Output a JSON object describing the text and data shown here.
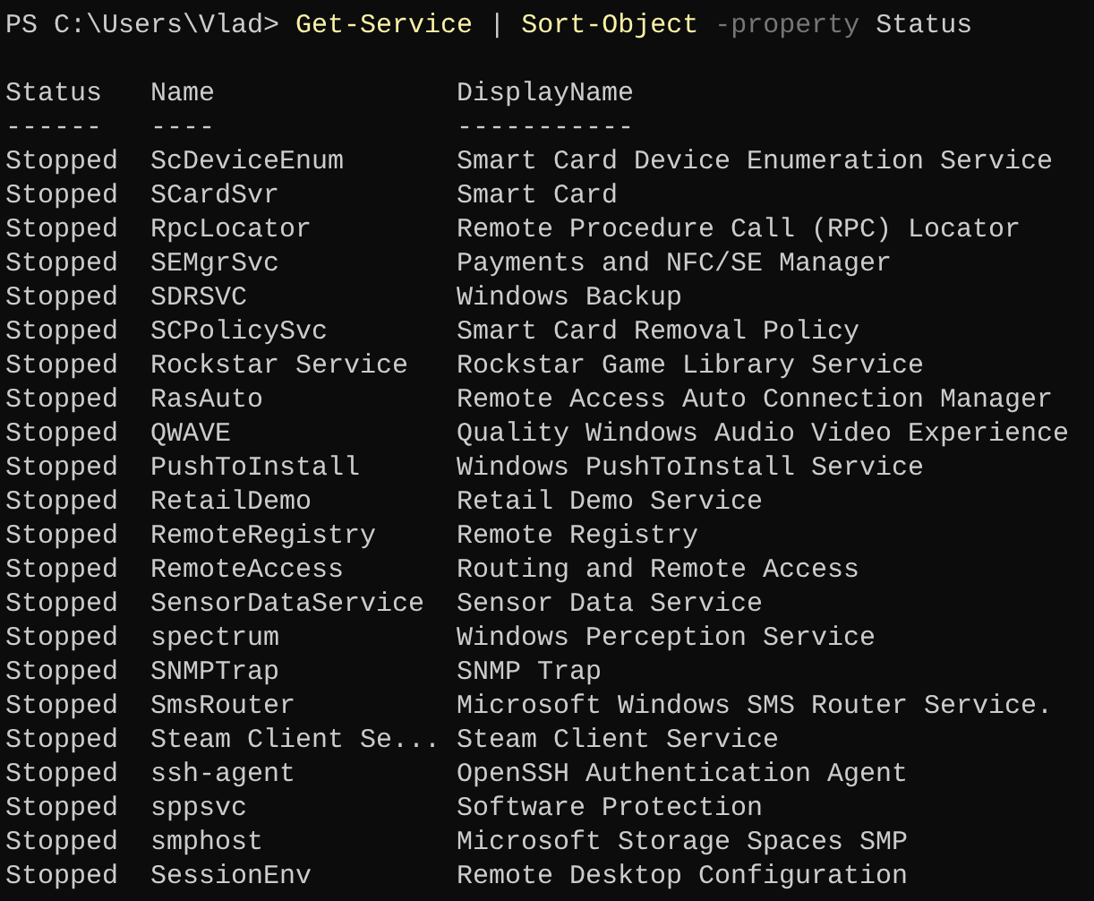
{
  "prompt": {
    "path": "PS C:\\Users\\Vlad>",
    "tokens": [
      {
        "text": "Get-Service",
        "kind": "command"
      },
      {
        "text": "|",
        "kind": "operator"
      },
      {
        "text": "Sort-Object",
        "kind": "command"
      },
      {
        "text": "-property",
        "kind": "parameter"
      },
      {
        "text": "Status",
        "kind": "argument"
      }
    ]
  },
  "table": {
    "columns": [
      {
        "heading": "Status",
        "underline": "------"
      },
      {
        "heading": "Name",
        "underline": "----"
      },
      {
        "heading": "DisplayName",
        "underline": "-----------"
      }
    ],
    "rows": [
      [
        "Stopped",
        "ScDeviceEnum",
        "Smart Card Device Enumeration Service"
      ],
      [
        "Stopped",
        "SCardSvr",
        "Smart Card"
      ],
      [
        "Stopped",
        "RpcLocator",
        "Remote Procedure Call (RPC) Locator"
      ],
      [
        "Stopped",
        "SEMgrSvc",
        "Payments and NFC/SE Manager"
      ],
      [
        "Stopped",
        "SDRSVC",
        "Windows Backup"
      ],
      [
        "Stopped",
        "SCPolicySvc",
        "Smart Card Removal Policy"
      ],
      [
        "Stopped",
        "Rockstar Service",
        "Rockstar Game Library Service"
      ],
      [
        "Stopped",
        "RasAuto",
        "Remote Access Auto Connection Manager"
      ],
      [
        "Stopped",
        "QWAVE",
        "Quality Windows Audio Video Experience"
      ],
      [
        "Stopped",
        "PushToInstall",
        "Windows PushToInstall Service"
      ],
      [
        "Stopped",
        "RetailDemo",
        "Retail Demo Service"
      ],
      [
        "Stopped",
        "RemoteRegistry",
        "Remote Registry"
      ],
      [
        "Stopped",
        "RemoteAccess",
        "Routing and Remote Access"
      ],
      [
        "Stopped",
        "SensorDataService",
        "Sensor Data Service"
      ],
      [
        "Stopped",
        "spectrum",
        "Windows Perception Service"
      ],
      [
        "Stopped",
        "SNMPTrap",
        "SNMP Trap"
      ],
      [
        "Stopped",
        "SmsRouter",
        "Microsoft Windows SMS Router Service."
      ],
      [
        "Stopped",
        "Steam Client Se...",
        "Steam Client Service"
      ],
      [
        "Stopped",
        "ssh-agent",
        "OpenSSH Authentication Agent"
      ],
      [
        "Stopped",
        "sppsvc",
        "Software Protection"
      ],
      [
        "Stopped",
        "smphost",
        "Microsoft Storage Spaces SMP"
      ],
      [
        "Stopped",
        "SessionEnv",
        "Remote Desktop Configuration"
      ]
    ]
  }
}
